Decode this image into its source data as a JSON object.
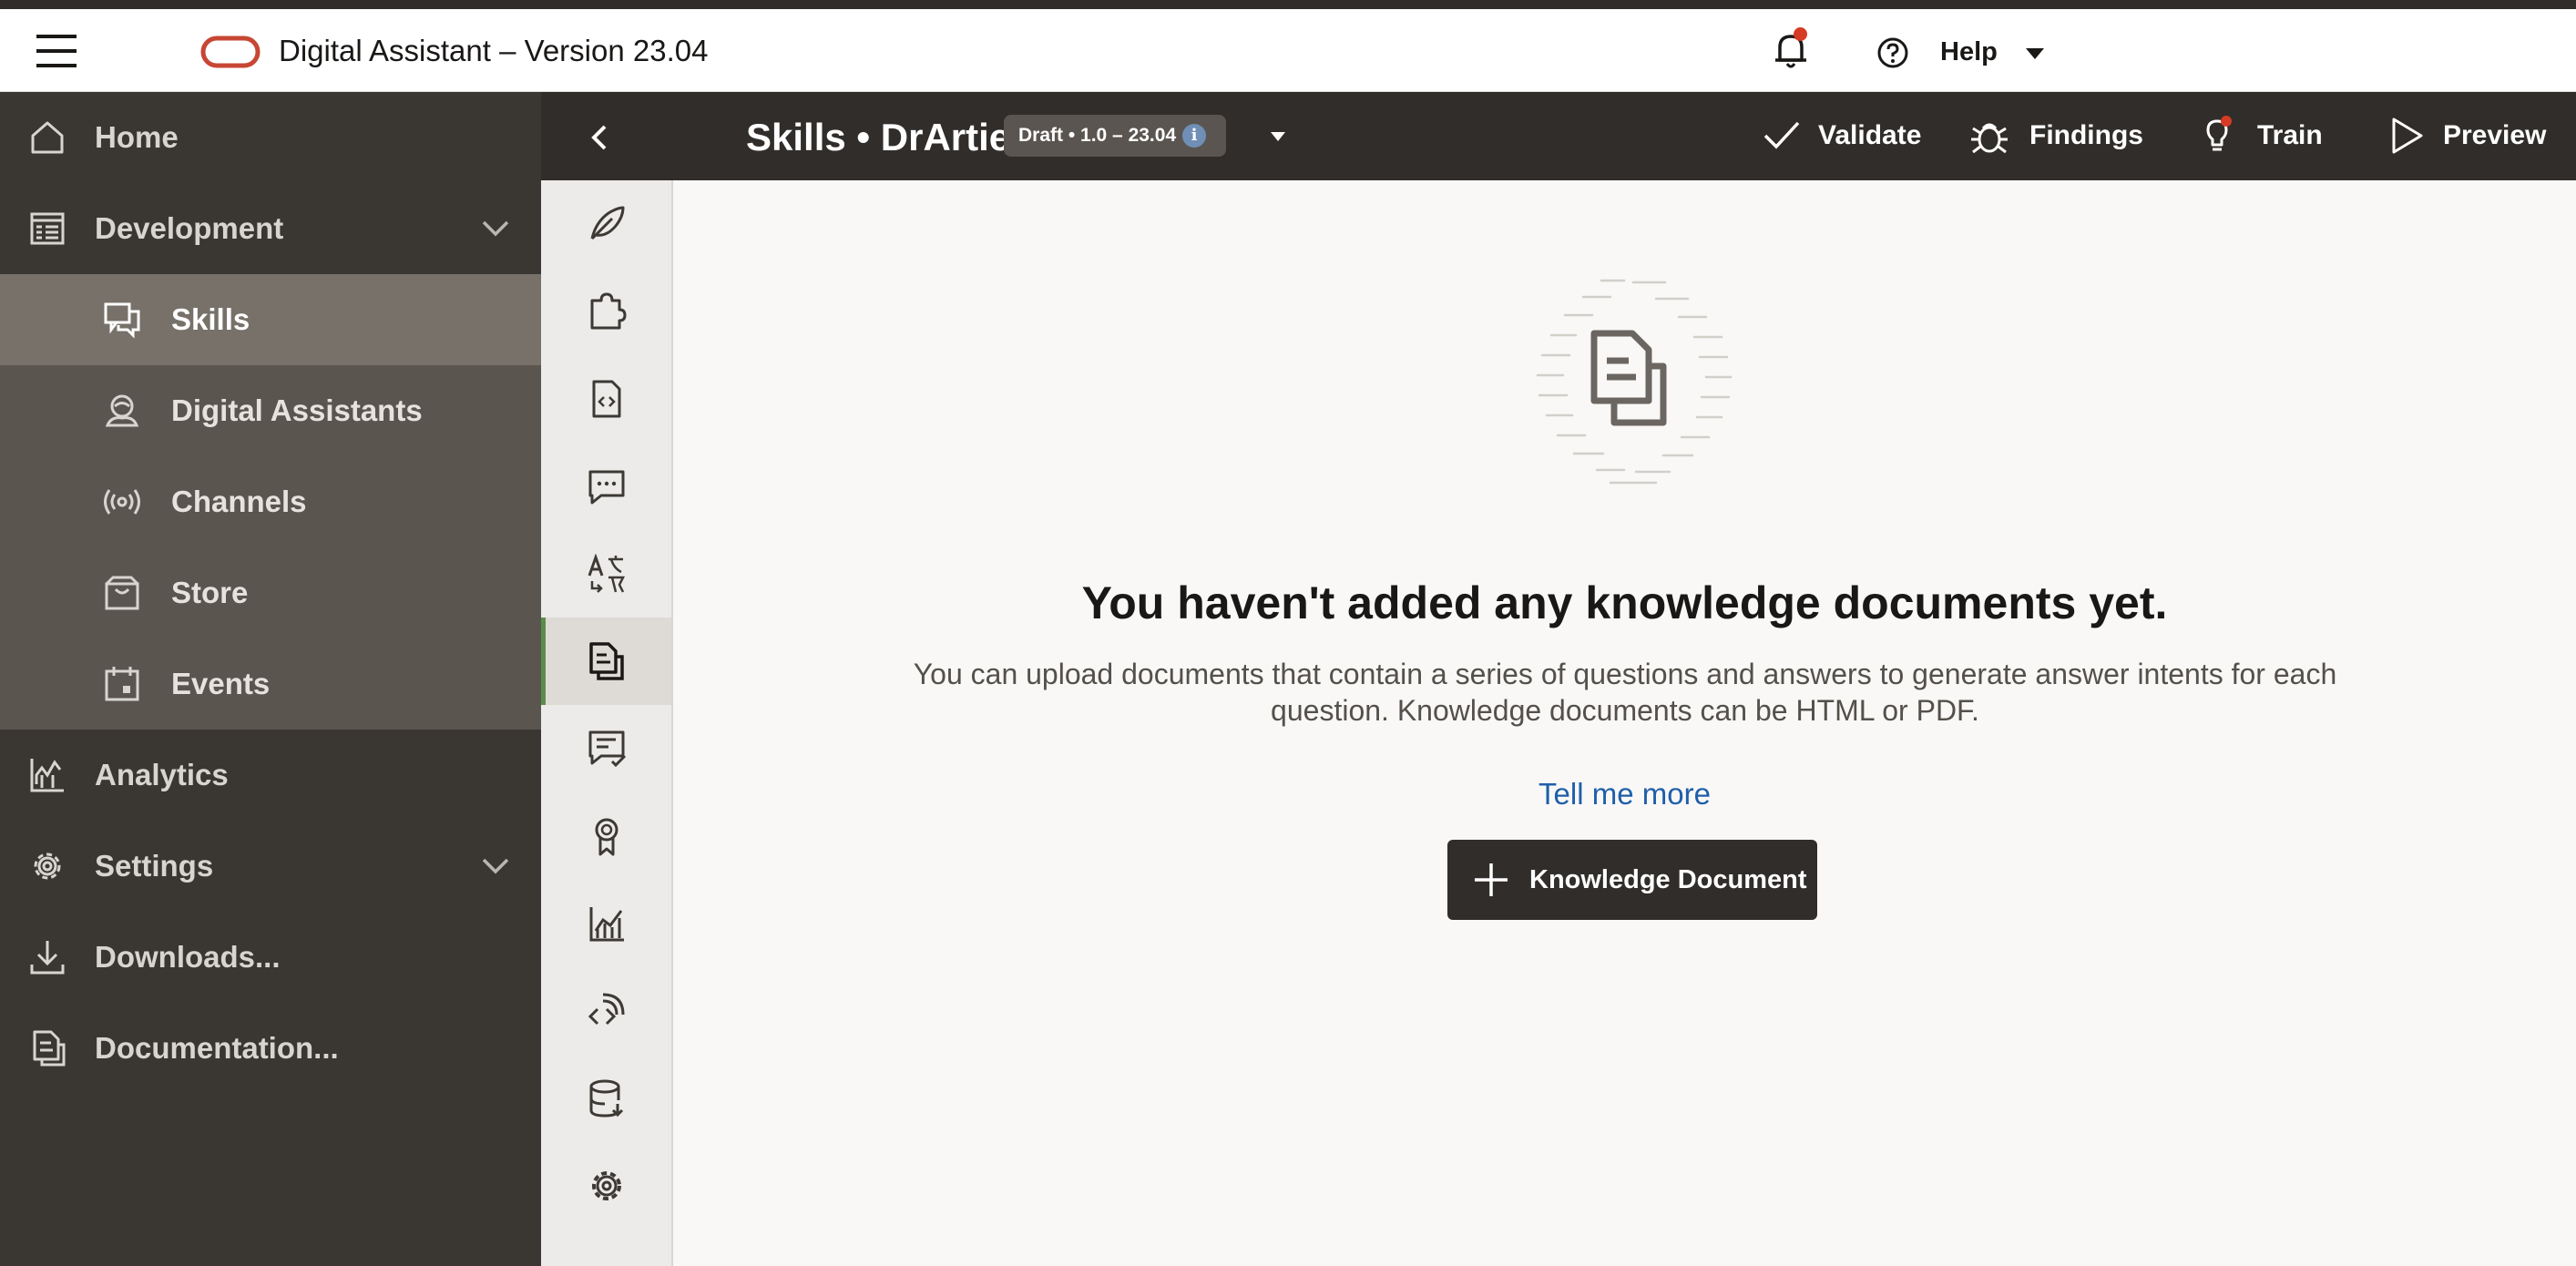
{
  "header": {
    "app_title": "Digital Assistant – Version 23.04",
    "help_label": "Help",
    "menu_icon": "hamburger-menu-icon",
    "logo": "oracle-logo",
    "notification_icon": "bell-icon"
  },
  "leftnav": {
    "items": [
      {
        "label": "Home",
        "icon": "home-icon"
      },
      {
        "label": "Development",
        "icon": "development-icon",
        "expanded": true
      },
      {
        "label": "Analytics",
        "icon": "analytics-icon"
      },
      {
        "label": "Settings",
        "icon": "settings-icon"
      },
      {
        "label": "Downloads...",
        "icon": "download-icon"
      },
      {
        "label": "Documentation...",
        "icon": "documentation-icon"
      }
    ],
    "sub_items": [
      {
        "label": "Skills",
        "icon": "skills-icon",
        "selected": true
      },
      {
        "label": "Digital Assistants",
        "icon": "digital-assistant-icon"
      },
      {
        "label": "Channels",
        "icon": "channels-icon"
      },
      {
        "label": "Store",
        "icon": "store-icon"
      },
      {
        "label": "Events",
        "icon": "events-icon"
      }
    ]
  },
  "skillbar": {
    "title": "Skills • DrArtie",
    "badge": "Draft • 1.0 – 23.04",
    "buttons": [
      {
        "label": "Validate",
        "icon": "checkmark-icon"
      },
      {
        "label": "Findings",
        "icon": "bug-icon"
      },
      {
        "label": "Train",
        "icon": "train-icon"
      },
      {
        "label": "Preview",
        "icon": "play-icon"
      }
    ]
  },
  "rail": {
    "items": [
      {
        "icon": "feather-icon"
      },
      {
        "icon": "puzzle-icon"
      },
      {
        "icon": "code-document-icon"
      },
      {
        "icon": "chat-icon"
      },
      {
        "icon": "translate-icon"
      },
      {
        "icon": "knowledge-document-icon",
        "active": true
      },
      {
        "icon": "conversation-check-icon"
      },
      {
        "icon": "badge-icon"
      },
      {
        "icon": "insights-icon"
      },
      {
        "icon": "api-icon"
      },
      {
        "icon": "database-icon"
      },
      {
        "icon": "settings-icon"
      }
    ]
  },
  "main": {
    "title": "You haven't added any knowledge documents yet.",
    "description": "You can upload documents that contain a series of questions and answers to generate answer intents for each question. Knowledge documents can be HTML or PDF.",
    "link": "Tell me more",
    "add_button": "Knowledge Document"
  },
  "colors": {
    "header_bg": "#ffffff",
    "nav_bg": "#3a3632",
    "nav_group_bg": "#5a554f",
    "nav_selected_bg": "#77716a",
    "toolbar_bg": "#312d2a",
    "link": "#1f5fa8",
    "accent": "#5b8d4a",
    "notification_dot": "#d63b25",
    "logo_red": "#c74634"
  }
}
